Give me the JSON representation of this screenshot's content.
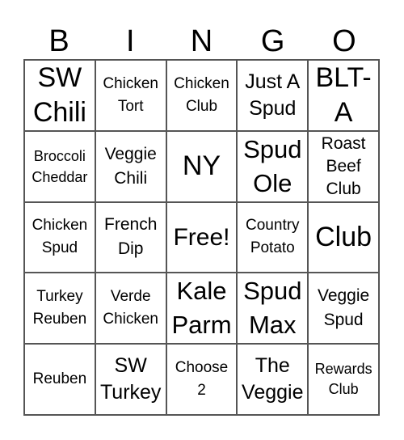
{
  "header": [
    "B",
    "I",
    "N",
    "G",
    "O"
  ],
  "cells": [
    [
      "SW\nChili",
      "Chicken\nTort",
      "Chicken\nClub",
      "Just A\nSpud",
      "BLT-\nA"
    ],
    [
      "Broccoli\nCheddar",
      "Veggie\nChili",
      "NY",
      "Spud\nOle",
      "Roast\nBeef\nClub"
    ],
    [
      "Chicken\nSpud",
      "French\nDip",
      "Free!",
      "Country\nPotato",
      "Club"
    ],
    [
      "Turkey\nReuben",
      "Verde\nChicken",
      "Kale\nParm",
      "Spud\nMax",
      "Veggie\nSpud"
    ],
    [
      "Reuben",
      "SW\nTurkey",
      "Choose\n2",
      "The\nVeggie",
      "Rewards\nClub"
    ]
  ]
}
